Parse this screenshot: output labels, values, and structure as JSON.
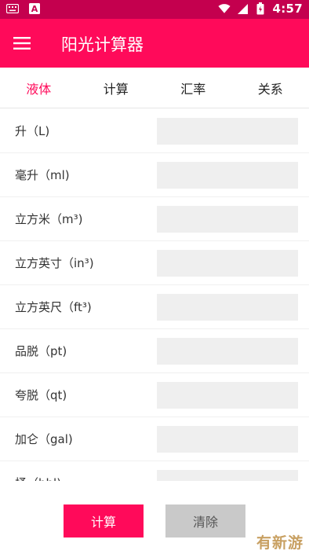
{
  "status_bar": {
    "time": "4:57",
    "icons": [
      "keyboard-icon",
      "letter-a-icon",
      "wifi-icon",
      "signal-icon",
      "battery-icon"
    ],
    "notification_letter": "A"
  },
  "app_bar": {
    "title": "阳光计算器",
    "menu_icon": "hamburger-menu-icon"
  },
  "tabs": [
    {
      "label": "液体",
      "active": true
    },
    {
      "label": "计算",
      "active": false
    },
    {
      "label": "汇率",
      "active": false
    },
    {
      "label": "关系",
      "active": false
    }
  ],
  "units": [
    {
      "label": "升（L)",
      "value": ""
    },
    {
      "label": "毫升（ml)",
      "value": ""
    },
    {
      "label": "立方米（m³)",
      "value": ""
    },
    {
      "label": "立方英寸（in³)",
      "value": ""
    },
    {
      "label": "立方英尺（ft³)",
      "value": ""
    },
    {
      "label": "品脱（pt)",
      "value": ""
    },
    {
      "label": "夸脱（qt)",
      "value": ""
    },
    {
      "label": "加仑（gal)",
      "value": ""
    },
    {
      "label": "桶（bbl)",
      "value": ""
    }
  ],
  "buttons": {
    "calculate": "计算",
    "clear": "清除"
  },
  "watermark": "有新游",
  "colors": {
    "primary": "#ff0a5a",
    "status_bar": "#c4004e",
    "input_bg": "#efefef",
    "clear_button": "#c9c9c9",
    "watermark": "#c8a062"
  }
}
